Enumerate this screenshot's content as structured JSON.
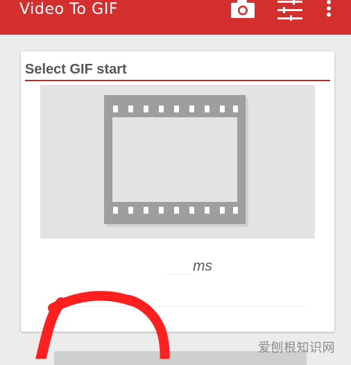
{
  "app_bar": {
    "title": "Video To GIF",
    "color": "#d32f2f",
    "actions": [
      {
        "icon": "camera-icon"
      },
      {
        "icon": "tune-icon"
      },
      {
        "icon": "more-vert-icon"
      }
    ]
  },
  "card": {
    "title": "Select GIF start",
    "accent_color": "#c62828",
    "preview_icon": "film-strip-icon",
    "time_unit": "ms"
  },
  "watermark": "爱刨根知识网"
}
